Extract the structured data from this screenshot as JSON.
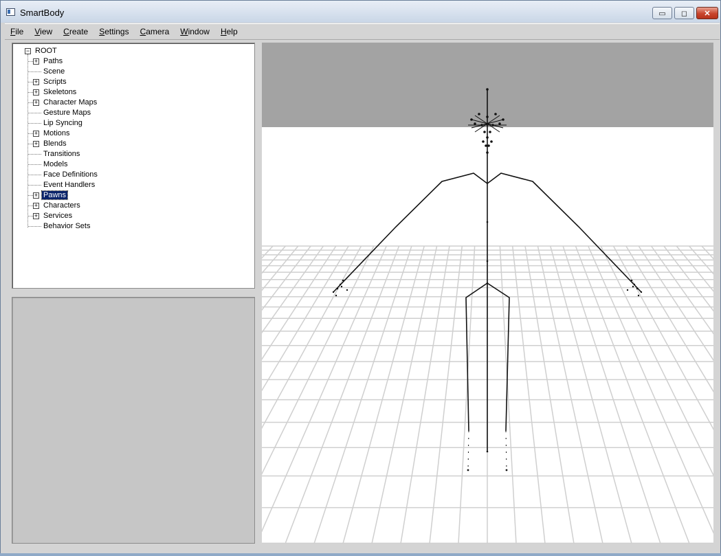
{
  "window": {
    "title": "SmartBody",
    "controls": {
      "minimize": "▭",
      "maximize": "◻",
      "close": "✕"
    }
  },
  "menubar": [
    {
      "key": "F",
      "rest": "ile"
    },
    {
      "key": "V",
      "rest": "iew"
    },
    {
      "key": "C",
      "rest": "reate"
    },
    {
      "key": "S",
      "rest": "ettings"
    },
    {
      "key": "C",
      "rest": "amera"
    },
    {
      "key": "W",
      "rest": "indow"
    },
    {
      "key": "H",
      "rest": "elp"
    }
  ],
  "tree": {
    "root": {
      "label": "ROOT",
      "expander": "−"
    },
    "items": [
      {
        "label": "Paths",
        "expandable": true
      },
      {
        "label": "Scene",
        "expandable": false
      },
      {
        "label": "Scripts",
        "expandable": true
      },
      {
        "label": "Skeletons",
        "expandable": true
      },
      {
        "label": "Character Maps",
        "expandable": true
      },
      {
        "label": "Gesture Maps",
        "expandable": false
      },
      {
        "label": "Lip Syncing",
        "expandable": false
      },
      {
        "label": "Motions",
        "expandable": true
      },
      {
        "label": "Blends",
        "expandable": true
      },
      {
        "label": "Transitions",
        "expandable": false
      },
      {
        "label": "Models",
        "expandable": false
      },
      {
        "label": "Face Definitions",
        "expandable": false
      },
      {
        "label": "Event Handlers",
        "expandable": false
      },
      {
        "label": "Pawns",
        "expandable": true,
        "selected": true
      },
      {
        "label": "Characters",
        "expandable": true
      },
      {
        "label": "Services",
        "expandable": true
      },
      {
        "label": "Behavior Sets",
        "expandable": false
      }
    ],
    "expander_glyph": "+"
  },
  "viewport": {
    "sky_color": "#a3a3a3",
    "floor_color": "#ffffff",
    "grid_color": "#cfcfcf",
    "skeleton_color": "#111111"
  }
}
